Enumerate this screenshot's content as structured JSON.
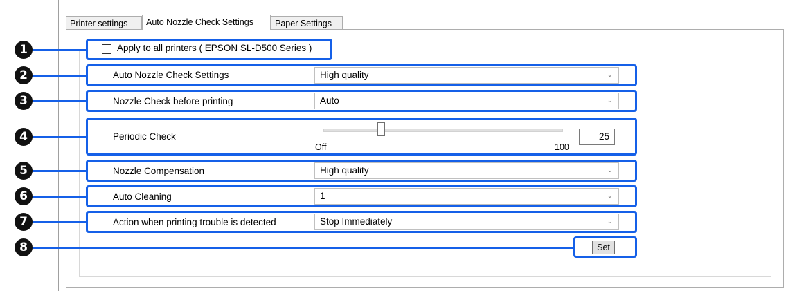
{
  "tabs": [
    "Printer settings",
    "Auto Nozzle Check Settings",
    "Paper Settings"
  ],
  "active_tab": "Auto Nozzle Check Settings",
  "apply_all": {
    "label": "Apply to all printers ( EPSON SL-D500 Series )",
    "checked": false
  },
  "settings": {
    "auto_nozzle": {
      "label": "Auto Nozzle Check Settings",
      "value": "High quality"
    },
    "nozzle_before": {
      "label": "Nozzle Check before printing",
      "value": "Auto"
    },
    "periodic": {
      "label": "Periodic Check",
      "value": "25",
      "min_label": "Off",
      "max_label": "100"
    },
    "compensation": {
      "label": "Nozzle Compensation",
      "value": "High quality"
    },
    "cleaning": {
      "label": "Auto Cleaning",
      "value": "1"
    },
    "trouble_action": {
      "label": "Action when printing trouble is detected",
      "value": "Stop Immediately"
    }
  },
  "set_button": "Set",
  "callouts": [
    "1",
    "2",
    "3",
    "4",
    "5",
    "6",
    "7",
    "8"
  ],
  "colors": {
    "highlight": "#1560e8",
    "callout_bg": "#111111"
  }
}
